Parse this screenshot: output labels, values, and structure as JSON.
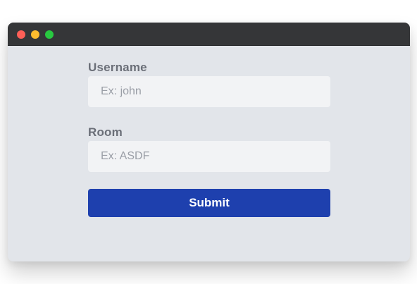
{
  "window": {
    "controls": {
      "close_color": "#fe5f57",
      "minimize_color": "#febc2e",
      "maximize_color": "#28c840"
    },
    "titlebar_color": "#353638",
    "background_color": "#e2e5ea"
  },
  "form": {
    "username": {
      "label": "Username",
      "value": "",
      "placeholder": "Ex: john"
    },
    "room": {
      "label": "Room",
      "value": "",
      "placeholder": "Ex: ASDF"
    },
    "submit_label": "Submit",
    "submit_color": "#1e40ae"
  }
}
